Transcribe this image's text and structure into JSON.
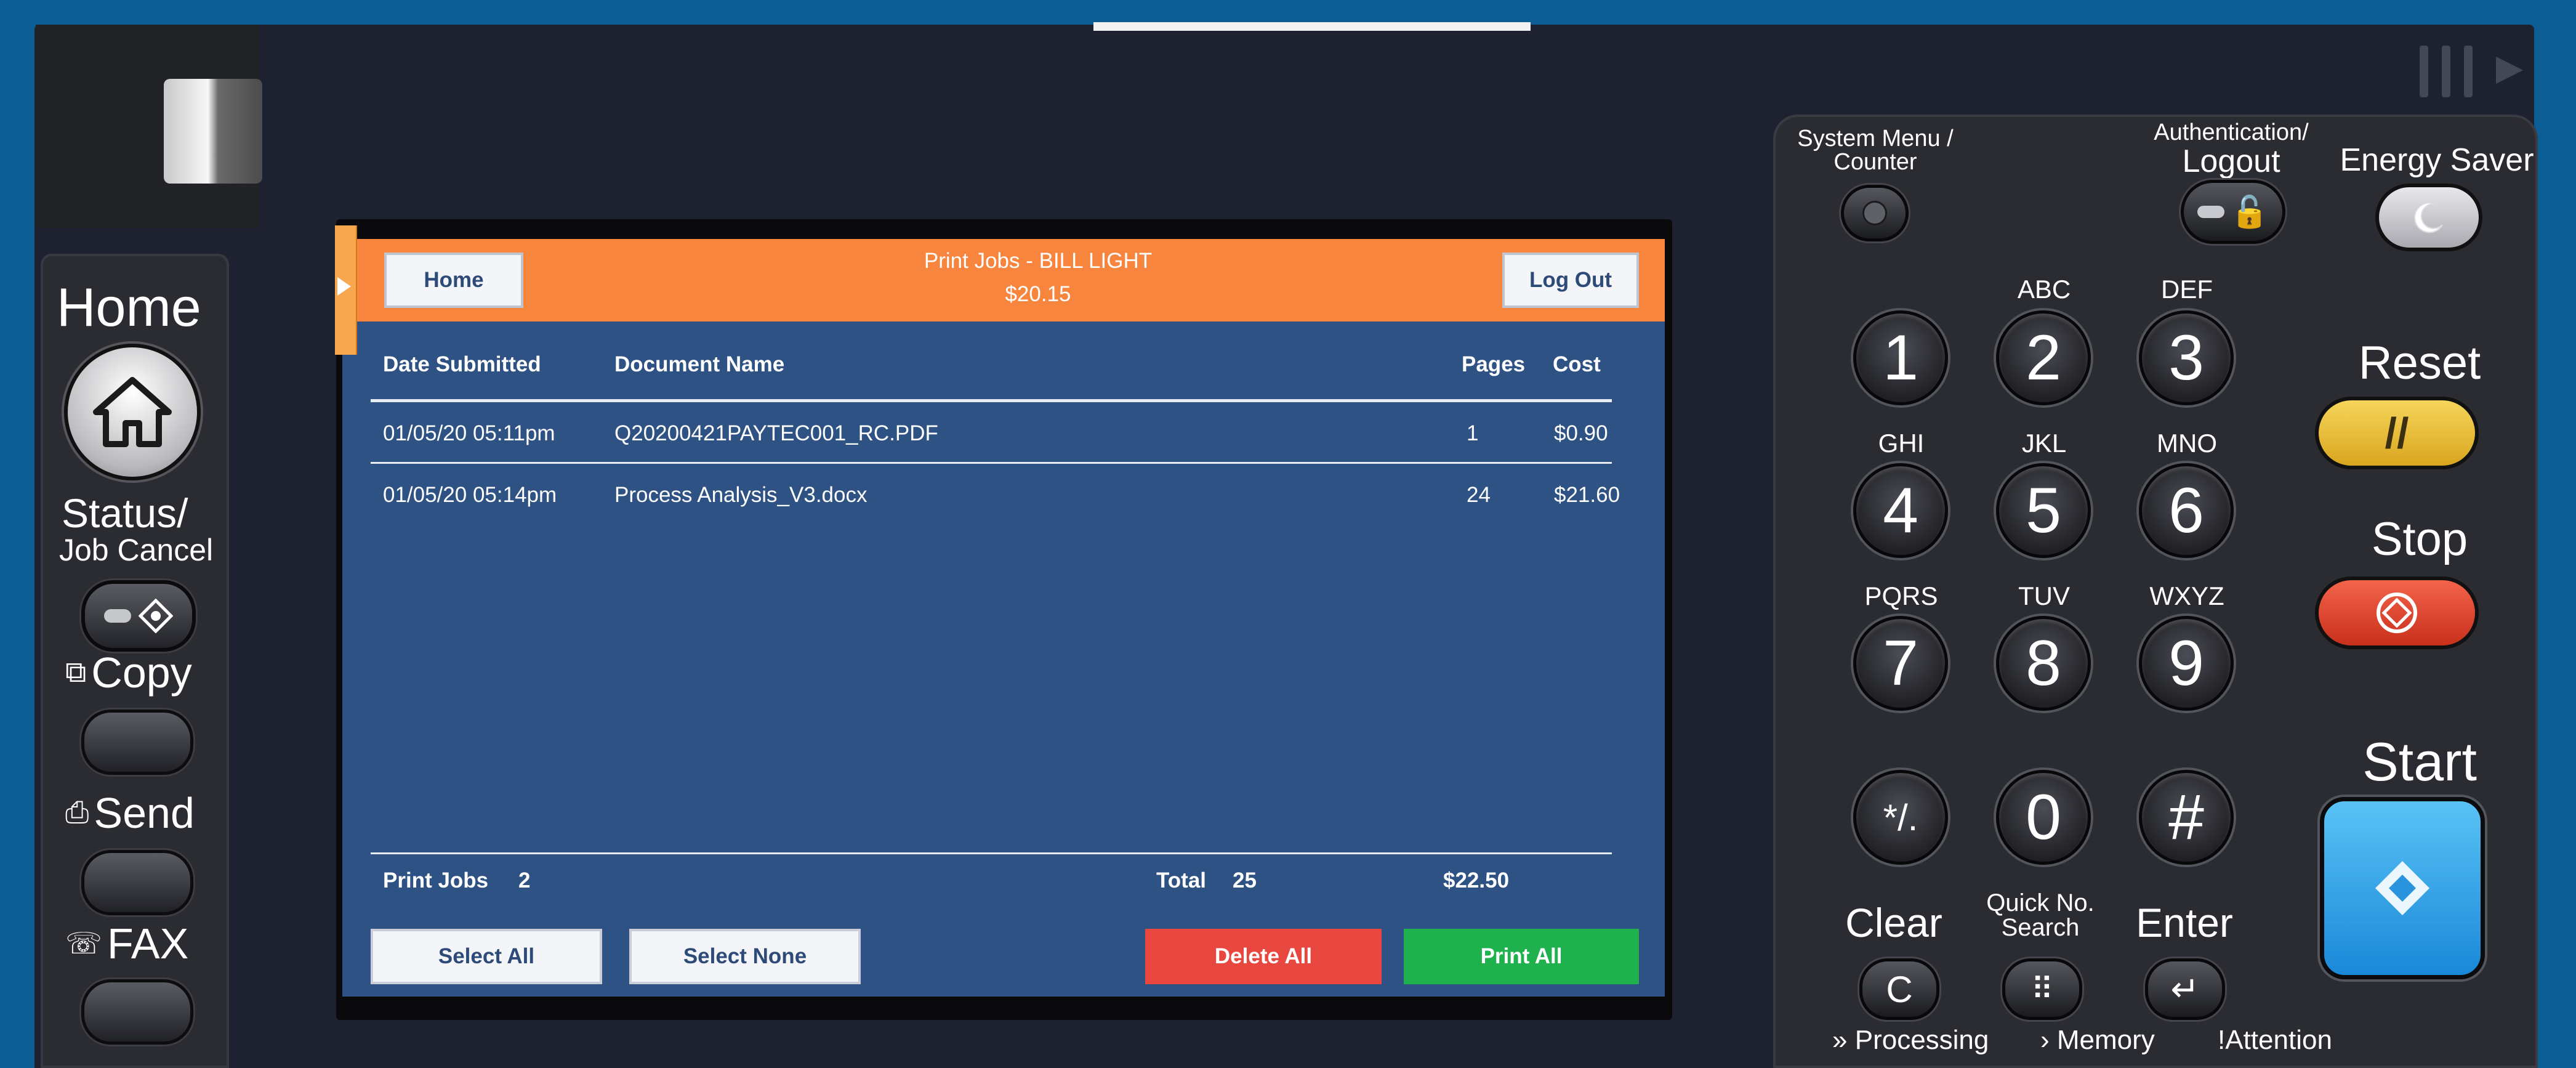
{
  "left_panel": {
    "home_label": "Home",
    "status_label_1": "Status/",
    "status_label_2": "Job Cancel",
    "copy_label": "Copy",
    "send_label": "Send",
    "fax_label": "FAX"
  },
  "screen": {
    "home_button": "Home",
    "title": "Print Jobs - BILL LIGHT",
    "balance": "$20.15",
    "logout_button": "Log Out",
    "columns": [
      "Date Submitted",
      "Document Name",
      "Pages",
      "Cost"
    ],
    "rows": [
      {
        "date": "01/05/20 05:11pm",
        "name": "Q20200421PAYTEC001_RC.PDF",
        "pages": "1",
        "cost": "$0.90"
      },
      {
        "date": "01/05/20 05:14pm",
        "name": "Process Analysis_V3.docx",
        "pages": "24",
        "cost": "$21.60"
      }
    ],
    "footer": {
      "jobs_label": "Print Jobs",
      "jobs_count": "2",
      "total_label": "Total",
      "total_pages": "25",
      "total_cost": "$22.50"
    },
    "buttons": {
      "select_all": "Select All",
      "select_none": "Select None",
      "delete_all": "Delete All",
      "print_all": "Print All"
    },
    "colors": {
      "title_bar": "#f7853e",
      "background": "#2e5283",
      "delete": "#e8473f",
      "print": "#1fb14d"
    }
  },
  "keypad": {
    "system_menu_1": "System Menu /",
    "system_menu_2": "Counter",
    "auth_1": "Authentication/",
    "auth_2": "Logout",
    "energy_saver": "Energy Saver",
    "reset": "Reset",
    "stop": "Stop",
    "start": "Start",
    "clear": "Clear",
    "quick_1": "Quick No.",
    "quick_2": "Search",
    "enter": "Enter",
    "letters": {
      "k2": "ABC",
      "k3": "DEF",
      "k4": "GHI",
      "k5": "JKL",
      "k6": "MNO",
      "k7": "PQRS",
      "k8": "TUV",
      "k9": "WXYZ"
    },
    "keys": {
      "k1": "1",
      "k2": "2",
      "k3": "3",
      "k4": "4",
      "k5": "5",
      "k6": "6",
      "k7": "7",
      "k8": "8",
      "k9": "9",
      "k0": "0",
      "kstar": "*/.",
      "khash": "#"
    },
    "indicators": {
      "processing": "Processing",
      "memory": "Memory",
      "attention": "Attention"
    }
  }
}
